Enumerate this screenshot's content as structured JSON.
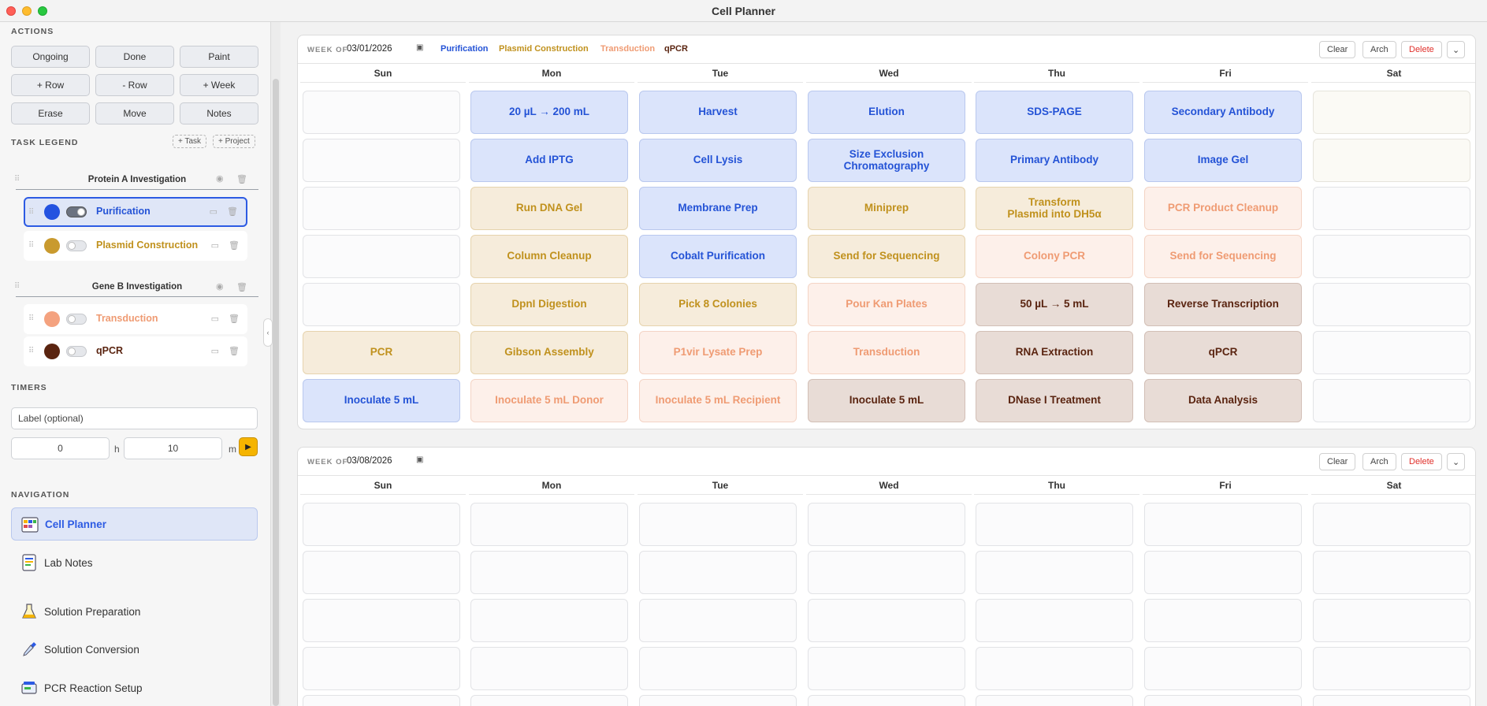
{
  "window": {
    "title": "Cell Planner"
  },
  "sidebar": {
    "actions_heading": "ACTIONS",
    "actions": [
      "Ongoing",
      "Done",
      "Paint",
      "+ Row",
      "- Row",
      "+ Week",
      "Erase",
      "Move",
      "Notes"
    ],
    "legend_heading": "TASK LEGEND",
    "add_task": "+ Task",
    "add_project": "+ Project",
    "projects": [
      {
        "title": "Protein A Investigation",
        "tasks": [
          {
            "label": "Purification",
            "color": "#2453e0",
            "on": true
          },
          {
            "label": "Plasmid Construction",
            "color": "#c99a2e",
            "on": false
          }
        ]
      },
      {
        "title": "Gene B Investigation",
        "tasks": [
          {
            "label": "Transduction",
            "color": "#f4a27f",
            "on": false
          },
          {
            "label": "qPCR",
            "color": "#5a2410",
            "on": false
          }
        ]
      }
    ],
    "timers_heading": "TIMERS",
    "timer_label_placeholder": "Label (optional)",
    "timer_hours": "0",
    "timer_hours_unit": "h",
    "timer_minutes": "10",
    "timer_minutes_unit": "m",
    "navigation_heading": "NAVIGATION",
    "nav": [
      {
        "label": "Cell Planner",
        "icon": "calendar-grid-icon",
        "active": true
      },
      {
        "label": "Lab Notes",
        "icon": "notes-icon",
        "active": false
      },
      {
        "label": "Solution Preparation",
        "icon": "flask-icon",
        "active": false
      },
      {
        "label": "Solution Conversion",
        "icon": "pipette-icon",
        "active": false
      },
      {
        "label": "PCR Reaction Setup",
        "icon": "pcr-machine-icon",
        "active": false
      }
    ]
  },
  "weeks": [
    {
      "label": "WEEK OF",
      "date": "03/01/2026",
      "legend": [
        "Purification",
        "Plasmid Construction",
        "Transduction",
        "qPCR"
      ],
      "buttons": {
        "clear": "Clear",
        "arch": "Arch",
        "delete": "Delete"
      },
      "days": [
        "Sun",
        "Mon",
        "Tue",
        "Wed",
        "Thu",
        "Fri",
        "Sat"
      ],
      "rows": [
        [
          {
            "t": "",
            "k": "empty"
          },
          {
            "t": "20 µL → 200 mL",
            "k": "purif"
          },
          {
            "t": "Harvest",
            "k": "purif"
          },
          {
            "t": "Elution",
            "k": "purif"
          },
          {
            "t": "SDS-PAGE",
            "k": "purif"
          },
          {
            "t": "Secondary Antibody",
            "k": "purif"
          },
          {
            "t": "",
            "k": "sat"
          }
        ],
        [
          {
            "t": "",
            "k": "empty"
          },
          {
            "t": "Add IPTG",
            "k": "purif"
          },
          {
            "t": "Cell Lysis",
            "k": "purif"
          },
          {
            "t": "Size Exclusion\nChromatography",
            "k": "purif"
          },
          {
            "t": "Primary Antibody",
            "k": "purif"
          },
          {
            "t": "Image Gel",
            "k": "purif"
          },
          {
            "t": "",
            "k": "sat"
          }
        ],
        [
          {
            "t": "",
            "k": "empty"
          },
          {
            "t": "Run DNA Gel",
            "k": "plasmid"
          },
          {
            "t": "Membrane Prep",
            "k": "purif"
          },
          {
            "t": "Miniprep",
            "k": "plasmid"
          },
          {
            "t": "Transform\nPlasmid into DH5α",
            "k": "plasmid"
          },
          {
            "t": "PCR Product Cleanup",
            "k": "trans"
          },
          {
            "t": "",
            "k": "empty"
          }
        ],
        [
          {
            "t": "",
            "k": "empty"
          },
          {
            "t": "Column Cleanup",
            "k": "plasmid"
          },
          {
            "t": "Cobalt Purification",
            "k": "purif"
          },
          {
            "t": "Send for Sequencing",
            "k": "plasmid"
          },
          {
            "t": "Colony PCR",
            "k": "trans"
          },
          {
            "t": "Send for Sequencing",
            "k": "trans"
          },
          {
            "t": "",
            "k": "empty"
          }
        ],
        [
          {
            "t": "",
            "k": "empty"
          },
          {
            "t": "DpnI Digestion",
            "k": "plasmid"
          },
          {
            "t": "Pick 8 Colonies",
            "k": "plasmid"
          },
          {
            "t": "Pour Kan Plates",
            "k": "trans"
          },
          {
            "t": "50 µL → 5 mL",
            "k": "qpcr"
          },
          {
            "t": "Reverse Transcription",
            "k": "qpcr"
          },
          {
            "t": "",
            "k": "empty"
          }
        ],
        [
          {
            "t": "PCR",
            "k": "plasmid"
          },
          {
            "t": "Gibson Assembly",
            "k": "plasmid"
          },
          {
            "t": "P1vir Lysate Prep",
            "k": "trans"
          },
          {
            "t": "Transduction",
            "k": "trans"
          },
          {
            "t": "RNA Extraction",
            "k": "qpcr"
          },
          {
            "t": "qPCR",
            "k": "qpcr"
          },
          {
            "t": "",
            "k": "empty"
          }
        ],
        [
          {
            "t": "Inoculate 5 mL",
            "k": "purif"
          },
          {
            "t": "Inoculate 5 mL Donor",
            "k": "trans"
          },
          {
            "t": "Inoculate 5 mL Recipient",
            "k": "trans"
          },
          {
            "t": "Inoculate 5 mL",
            "k": "qpcr"
          },
          {
            "t": "DNase I Treatment",
            "k": "qpcr"
          },
          {
            "t": "Data Analysis",
            "k": "qpcr"
          },
          {
            "t": "",
            "k": "empty"
          }
        ]
      ]
    },
    {
      "label": "WEEK OF",
      "date": "03/08/2026",
      "legend": [],
      "buttons": {
        "clear": "Clear",
        "arch": "Arch",
        "delete": "Delete"
      },
      "days": [
        "Sun",
        "Mon",
        "Tue",
        "Wed",
        "Thu",
        "Fri",
        "Sat"
      ],
      "rows": [
        [
          {
            "t": "",
            "k": "empty"
          },
          {
            "t": "",
            "k": "empty"
          },
          {
            "t": "",
            "k": "empty"
          },
          {
            "t": "",
            "k": "empty"
          },
          {
            "t": "",
            "k": "empty"
          },
          {
            "t": "",
            "k": "empty"
          },
          {
            "t": "",
            "k": "empty"
          }
        ],
        [
          {
            "t": "",
            "k": "empty"
          },
          {
            "t": "",
            "k": "empty"
          },
          {
            "t": "",
            "k": "empty"
          },
          {
            "t": "",
            "k": "empty"
          },
          {
            "t": "",
            "k": "empty"
          },
          {
            "t": "",
            "k": "empty"
          },
          {
            "t": "",
            "k": "empty"
          }
        ],
        [
          {
            "t": "",
            "k": "empty"
          },
          {
            "t": "",
            "k": "empty"
          },
          {
            "t": "",
            "k": "empty"
          },
          {
            "t": "",
            "k": "empty"
          },
          {
            "t": "",
            "k": "empty"
          },
          {
            "t": "",
            "k": "empty"
          },
          {
            "t": "",
            "k": "empty"
          }
        ],
        [
          {
            "t": "",
            "k": "empty"
          },
          {
            "t": "",
            "k": "empty"
          },
          {
            "t": "",
            "k": "empty"
          },
          {
            "t": "",
            "k": "empty"
          },
          {
            "t": "",
            "k": "empty"
          },
          {
            "t": "",
            "k": "empty"
          },
          {
            "t": "",
            "k": "empty"
          }
        ],
        [
          {
            "t": "",
            "k": "empty"
          },
          {
            "t": "",
            "k": "empty"
          },
          {
            "t": "",
            "k": "empty"
          },
          {
            "t": "",
            "k": "empty"
          },
          {
            "t": "",
            "k": "empty"
          },
          {
            "t": "",
            "k": "empty"
          },
          {
            "t": "",
            "k": "empty"
          }
        ]
      ]
    }
  ]
}
